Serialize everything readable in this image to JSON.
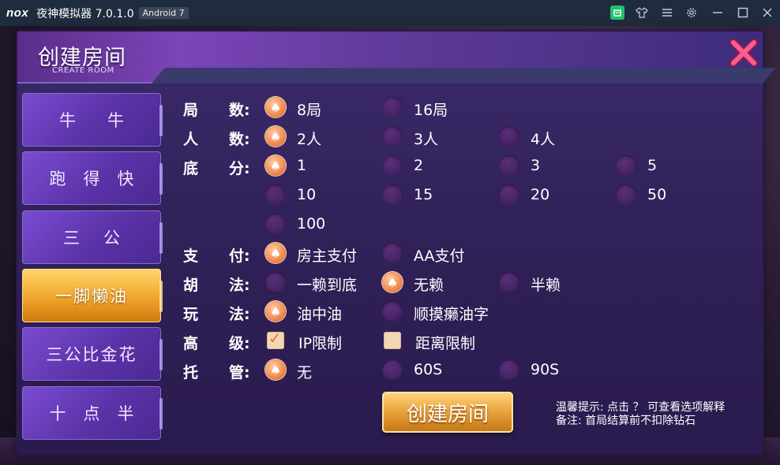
{
  "window": {
    "logo": "nox",
    "title": "夜神模拟器 7.0.1.0",
    "badge": "Android 7",
    "icons": [
      "store-icon",
      "shirt-icon",
      "menu-icon",
      "gear-icon",
      "minimize-icon",
      "maximize-icon",
      "close-icon"
    ]
  },
  "dialog": {
    "title": "创建房间",
    "subtitle": "CREATE ROOM"
  },
  "tabs": [
    {
      "label": "牛牛",
      "active": false
    },
    {
      "label": "跑得快",
      "active": false
    },
    {
      "label": "三公",
      "active": false
    },
    {
      "label": "一脚懒油",
      "active": true
    },
    {
      "label": "三公比金花",
      "active": false
    },
    {
      "label": "十点半",
      "active": false
    }
  ],
  "options": {
    "rounds": {
      "label_a": "局",
      "label_b": "数:",
      "choices": [
        "8局",
        "16局"
      ],
      "selected": 0
    },
    "players": {
      "label_a": "人",
      "label_b": "数:",
      "choices": [
        "2人",
        "3人",
        "4人"
      ],
      "selected": 0
    },
    "base": {
      "label_a": "底",
      "label_b": "分:",
      "choices": [
        "1",
        "2",
        "3",
        "5",
        "10",
        "15",
        "20",
        "50",
        "100"
      ],
      "selected": 0
    },
    "payment": {
      "label_a": "支",
      "label_b": "付:",
      "choices": [
        "房主支付",
        "AA支付"
      ],
      "selected": 0
    },
    "hu": {
      "label_a": "胡",
      "label_b": "法:",
      "choices": [
        "一赖到底",
        "无赖",
        "半赖"
      ],
      "selected": 1
    },
    "play": {
      "label_a": "玩",
      "label_b": "法:",
      "choices": [
        "油中油",
        "顺摸癞油字"
      ],
      "selected": 0
    },
    "advanced": {
      "label_a": "高",
      "label_b": "级:",
      "choices": [
        "IP限制",
        "距离限制"
      ],
      "checked": [
        true,
        false
      ]
    },
    "hosting": {
      "label_a": "托",
      "label_b": "管:",
      "choices": [
        "无",
        "60S",
        "90S"
      ],
      "selected": 0
    }
  },
  "create_button": "创建房间",
  "hint": {
    "line1": "温馨提示: 点击 ？ 可查看选项解释",
    "line2": "备注: 首局结算前不扣除钻石"
  },
  "colors": {
    "accent_gold": "#f0a52a",
    "tab_purple": "#5b33a8",
    "radio_selected": "#f08a50",
    "close_pink": "#ff4f8a"
  }
}
